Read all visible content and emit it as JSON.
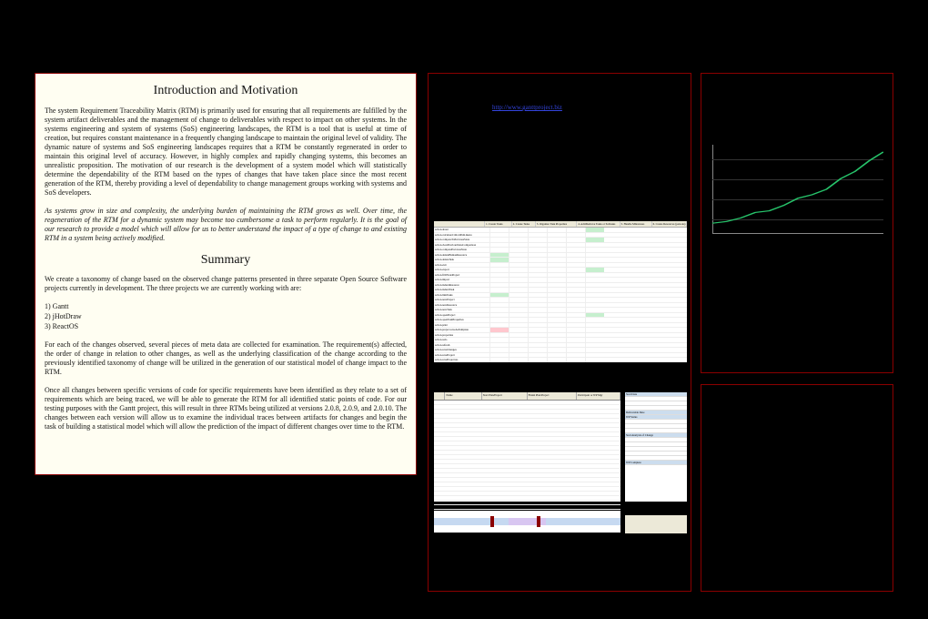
{
  "intro": {
    "heading1": "Introduction and Motivation",
    "para1": "The system Requirement Traceability Matrix (RTM) is primarily used for ensuring that all requirements are fulfilled by the system artifact deliverables and the management of change to deliverables with respect to impact on other systems. In the systems engineering and system of systems (SoS) engineering landscapes, the RTM is a tool that is useful at time of creation, but requires constant maintenance in a frequently changing landscape to maintain the original level of validity. The dynamic nature of systems and SoS engineering landscapes requires that a RTM be constantly regenerated in order to maintain this original level of accuracy. However, in highly complex and rapidly changing systems, this becomes an unrealistic proposition. The motivation of our research is the development of a system model which will statistically determine the dependability of the RTM based on the types of changes that have taken place since the most recent generation of the RTM, thereby providing a level of dependability to change management groups working with systems and SoS developers.",
    "para2": "As systems grow in size and complexity, the underlying burden of maintaining the RTM grows as well. Over time, the regeneration of the RTM for a dynamic system may become too cumbersome a task to perform regularly. It is the goal of our research to provide a model which will allow for us to better understand the impact of a type of change to and existing RTM in a system being actively modified.",
    "heading2": "Summary",
    "para3": "We create a taxonomy of change based on the observed change patterns presented in three separate Open Source Software projects currently in development. The three projects we are currently working with are:",
    "list": [
      "1)  Gantt",
      "2)  jHotDraw",
      "3)  ReactOS"
    ],
    "para4": "For each of the changes observed, several pieces of meta data are collected for examination. The requirement(s) affected, the order of change in relation to other changes, as well as the underlying classification of the change according to the previously identified taxonomy of change will be utilized in the generation of our statistical model of change impact to the RTM.",
    "para5": "Once all changes between specific versions of code for specific requirements have been identified as they relate to a set of requirements which are being traced, we will be able to generate the RTM for all identified static points of code. For our testing purposes with the Gantt project, this will result in three RTMs being utilized at versions 2.0.8, 2.0.9, and 2.0.10. The changes between each version will allow us to examine the individual traces between artifacts for changes and begin the task of building a statistical model which will allow the prediction of the impact of different changes over time to the RTM."
  },
  "url": "http://www.ganttproject.biz",
  "sheet_headers": [
    "",
    "1. Create Tasks",
    "2. Create Tasks",
    "3. Organize Task Properties",
    "4. Add/Remove Tasks or Subtasks",
    "5. Handle Milestones",
    "6. Create Resources (persons)"
  ],
  "sheet_rows": [
    "action.about",
    "action.calculateCriticalPath.menu",
    "action.compareToPreviousState",
    "action.clearPreviousStateComparison",
    "action.comparePreviousState",
    "action.deleteHumanResource",
    "action.deleteTask",
    "action.exit",
    "action.export",
    "action.fitWholeProject",
    "action.import",
    "action.indentResource",
    "action.indentTask",
    "action.linkTasks",
    "action.newProject",
    "action.newResource",
    "action.newTask",
    "action.openProject",
    "action.openTaskProperties",
    "action.print",
    "action.project.saveAsTemplate",
    "action.properties",
    "action.redo",
    "action.refresh",
    "action.saveChanges",
    "action.saveProject",
    "action.saveProjectAs",
    "action.SendMail",
    "action.ResourceDown",
    "action.ResourceUp",
    "action.SelectResource",
    "action.taskTab_moveDownTask",
    "action.taskTab_moveUpTask"
  ],
  "sheet_highlights": {
    "1": [
      5,
      6,
      13
    ],
    "6": [
      0,
      2,
      8,
      17
    ],
    "pink": [
      20
    ]
  },
  "gantt_headers": [
    "",
    "Name",
    "Start Plan/Project",
    "Finish Plan/Project",
    "Participant or WP Mgr"
  ],
  "gantt_right_items": [
    "Start Date",
    "",
    "",
    "",
    "Deliverable Date",
    "WP Status",
    "",
    "",
    "",
    "Start Analysis of Change",
    "",
    "",
    "",
    "",
    "",
    "WP Complete"
  ],
  "chart_data": {
    "type": "line",
    "x": [
      0,
      1,
      2,
      3,
      4,
      5,
      6,
      7,
      8,
      9,
      10,
      11,
      12
    ],
    "values": [
      12,
      14,
      18,
      24,
      26,
      32,
      40,
      44,
      50,
      62,
      70,
      82,
      92
    ],
    "ylim": [
      0,
      100
    ],
    "title": "",
    "xlabel": "",
    "ylabel": ""
  }
}
